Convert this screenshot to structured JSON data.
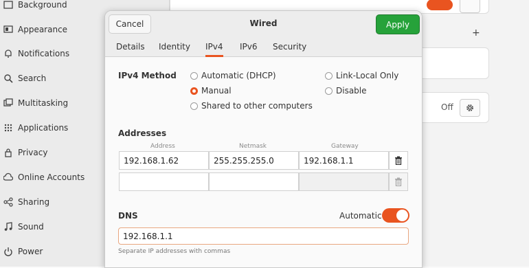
{
  "sidebar": {
    "items": [
      {
        "label": "Background",
        "icon": "background-icon"
      },
      {
        "label": "Appearance",
        "icon": "appearance-icon"
      },
      {
        "label": "Notifications",
        "icon": "bell-icon"
      },
      {
        "label": "Search",
        "icon": "search-icon"
      },
      {
        "label": "Multitasking",
        "icon": "multitasking-icon"
      },
      {
        "label": "Applications",
        "icon": "grid-icon"
      },
      {
        "label": "Privacy",
        "icon": "lock-icon"
      },
      {
        "label": "Online Accounts",
        "icon": "cloud-icon"
      },
      {
        "label": "Sharing",
        "icon": "share-icon"
      },
      {
        "label": "Sound",
        "icon": "music-note-icon"
      },
      {
        "label": "Power",
        "icon": "power-icon"
      }
    ]
  },
  "background": {
    "proxy_status": "Off"
  },
  "dialog": {
    "title": "Wired",
    "cancel_label": "Cancel",
    "apply_label": "Apply",
    "tabs": [
      "Details",
      "Identity",
      "IPv4",
      "IPv6",
      "Security"
    ],
    "active_tab": "IPv4"
  },
  "ipv4": {
    "method_label": "IPv4 Method",
    "methods": [
      {
        "label": "Automatic (DHCP)",
        "selected": false
      },
      {
        "label": "Manual",
        "selected": true
      },
      {
        "label": "Shared to other computers",
        "selected": false
      },
      {
        "label": "Link-Local Only",
        "selected": false
      },
      {
        "label": "Disable",
        "selected": false
      }
    ],
    "addresses_label": "Addresses",
    "columns": [
      "Address",
      "Netmask",
      "Gateway"
    ],
    "rows": [
      {
        "address": "192.168.1.62",
        "netmask": "255.255.255.0",
        "gateway": "192.168.1.1"
      },
      {
        "address": "",
        "netmask": "",
        "gateway": ""
      }
    ],
    "dns_label": "DNS",
    "dns_automatic_label": "Automatic",
    "dns_automatic_on": true,
    "dns_value": "192.168.1.1",
    "dns_hint": "Separate IP addresses with commas"
  },
  "colors": {
    "accent": "#e95420",
    "apply": "#26a23a"
  }
}
